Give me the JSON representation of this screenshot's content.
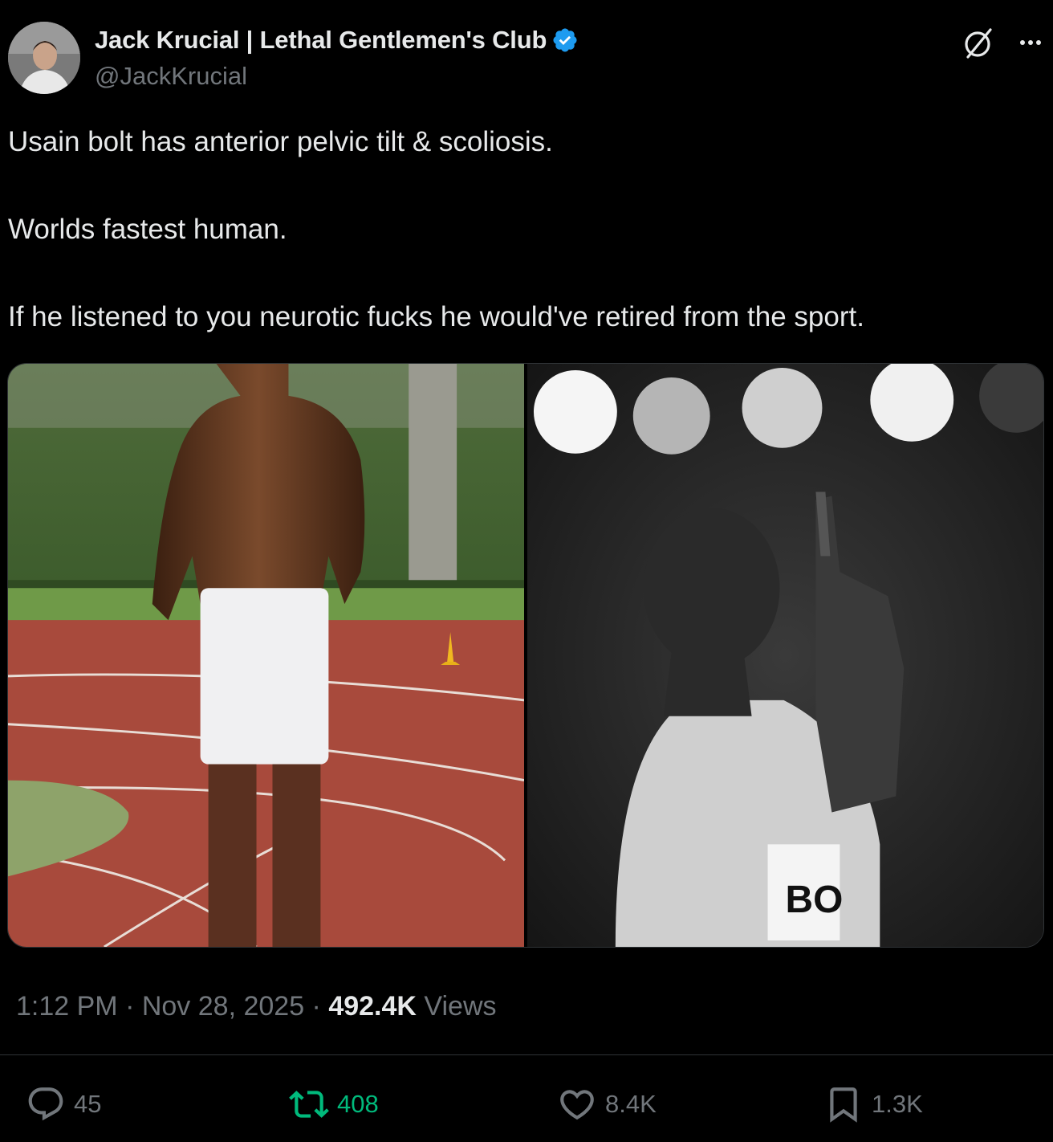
{
  "author": {
    "name": "Jack Krucial | Lethal Gentlemen's Club",
    "handle": "@JackKrucial",
    "verified": true
  },
  "tweet": {
    "paragraphs": [
      "Usain bolt has anterior pelvic tilt & scoliosis.",
      "Worlds fastest human.",
      "If he listened to you neurotic fucks he would've retired from the sport."
    ]
  },
  "media": {
    "images": [
      {
        "description_icon": "photo-icon"
      },
      {
        "description_icon": "photo-icon",
        "bib_text": "BO"
      }
    ]
  },
  "meta": {
    "time": "1:12 PM",
    "sep1": " · ",
    "date": "Nov 28, 2025",
    "sep2": " · ",
    "views_count": "492.4K",
    "views_label": " Views"
  },
  "actions": {
    "replies": "45",
    "reposts": "408",
    "likes": "8.4K",
    "bookmarks": "1.3K"
  },
  "colors": {
    "background": "#000000",
    "text": "#e7e9ea",
    "muted": "#71767b",
    "repost_active": "#00ba7c",
    "verified": "#1d9bf0"
  }
}
